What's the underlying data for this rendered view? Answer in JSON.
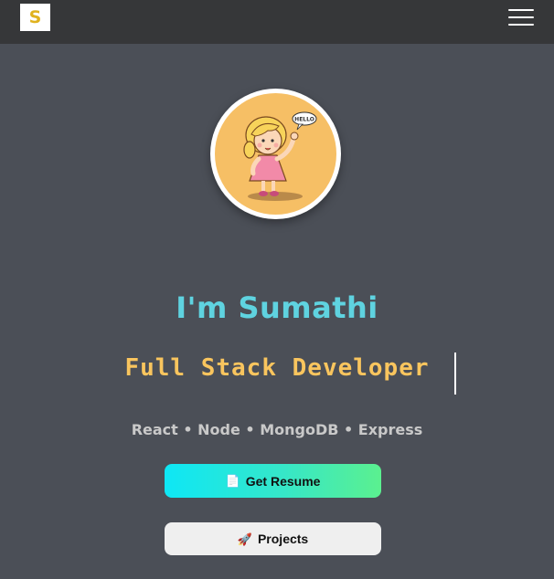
{
  "nav": {
    "logo_letter": "S",
    "menu_icon": "hamburger-icon"
  },
  "hero": {
    "avatar_icon": "girl-waving-hello-illustration",
    "speech_bubble": "HELLO",
    "title": "I'm Sumathi",
    "role": "Full Stack Developer",
    "skills": "React • Node • MongoDB • Express"
  },
  "buttons": {
    "resume_icon": "📄",
    "resume_label": "Get Resume",
    "projects_icon": "🚀",
    "projects_label": "Projects"
  },
  "colors": {
    "background": "#4b4f57",
    "navbar": "#363739",
    "title": "#5fd3e0",
    "role": "#f9c55e",
    "logo_letter": "#e0b21e"
  }
}
